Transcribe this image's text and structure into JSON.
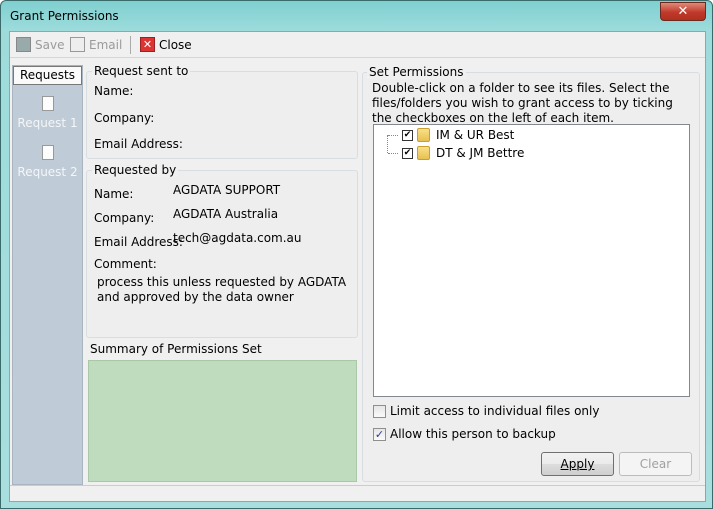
{
  "window": {
    "title": "Grant Permissions",
    "close_icon": "close-icon"
  },
  "toolbar": {
    "save": "Save",
    "email": "Email",
    "close": "Close"
  },
  "sidebar": {
    "header": "Requests",
    "items": [
      {
        "label": "Request 1"
      },
      {
        "label": "Request 2"
      }
    ]
  },
  "request_sent_to": {
    "title": "Request sent to",
    "name_label": "Name:",
    "company_label": "Company:",
    "email_label": "Email Address:"
  },
  "requested_by": {
    "title": "Requested by",
    "name_label": "Name:",
    "name": "AGDATA SUPPORT",
    "company_label": "Company:",
    "company": "AGDATA Australia",
    "email_label": "Email Address:",
    "email": "tech@agdata.com.au",
    "comment_label": "Comment:",
    "comment": "process this unless requested by AGDATA and approved by the data owner"
  },
  "summary": {
    "title": "Summary of Permissions Set",
    "color": "#bfdcbf"
  },
  "set_permissions": {
    "title": "Set Permissions",
    "instructions": "Double-click on a folder to see its files. Select the files/folders you wish to grant access to by ticking the checkboxes on the left of each item.",
    "tree": [
      {
        "label": "IM & UR Best",
        "checked": true
      },
      {
        "label": "DT & JM Bettre",
        "checked": true
      }
    ],
    "limit_access": {
      "label": "Limit access to individual files only",
      "checked": false
    },
    "allow_backup": {
      "label": "Allow this person to backup",
      "checked": true
    },
    "apply": "Apply",
    "clear": "Clear"
  }
}
